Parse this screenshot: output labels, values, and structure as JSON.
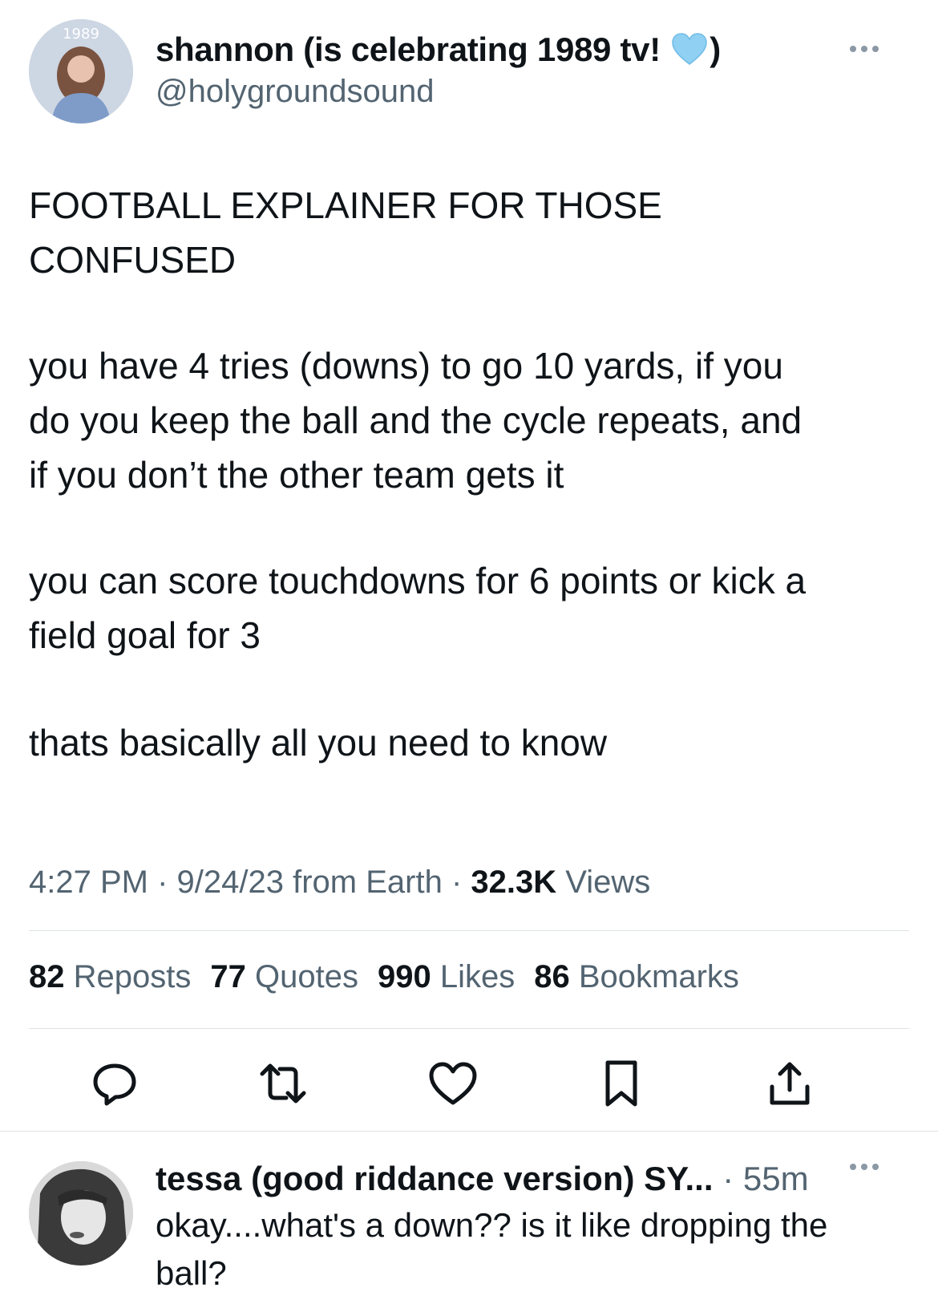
{
  "tweet": {
    "author_name": "shannon (is celebrating 1989 tv!",
    "author_name_end": ")",
    "handle": "@holygroundsound",
    "text_lines": [
      "FOOTBALL EXPLAINER FOR THOSE",
      "CONFUSED",
      "you have 4 tries (downs) to go 10 yards, if you",
      "do you keep the ball and the cycle repeats, and",
      "if you don’t the other team gets it",
      "you can score touchdowns for 6 points or kick a",
      "field goal for 3",
      "thats basically all you need to know"
    ],
    "time": "4:27 PM",
    "date": "9/24/23",
    "source": "from Earth",
    "views_count": "32.3K",
    "views_label": "Views",
    "avatar_badge": "1989"
  },
  "stats": [
    {
      "count": "82",
      "label": "Reposts"
    },
    {
      "count": "77",
      "label": "Quotes"
    },
    {
      "count": "990",
      "label": "Likes"
    },
    {
      "count": "86",
      "label": "Bookmarks"
    }
  ],
  "actions": [
    "reply-icon",
    "repost-icon",
    "like-icon",
    "bookmark-icon",
    "share-icon"
  ],
  "reply": {
    "author_name": "tessa (good riddance version) SY...",
    "time": "55m",
    "text_lines": [
      "okay....what's a down?? is it like dropping the",
      "ball?"
    ]
  },
  "colors": {
    "text": "#0f1419",
    "secondary": "#536471",
    "heart": "#8fd0f3",
    "divider": "#dfe3e6"
  }
}
